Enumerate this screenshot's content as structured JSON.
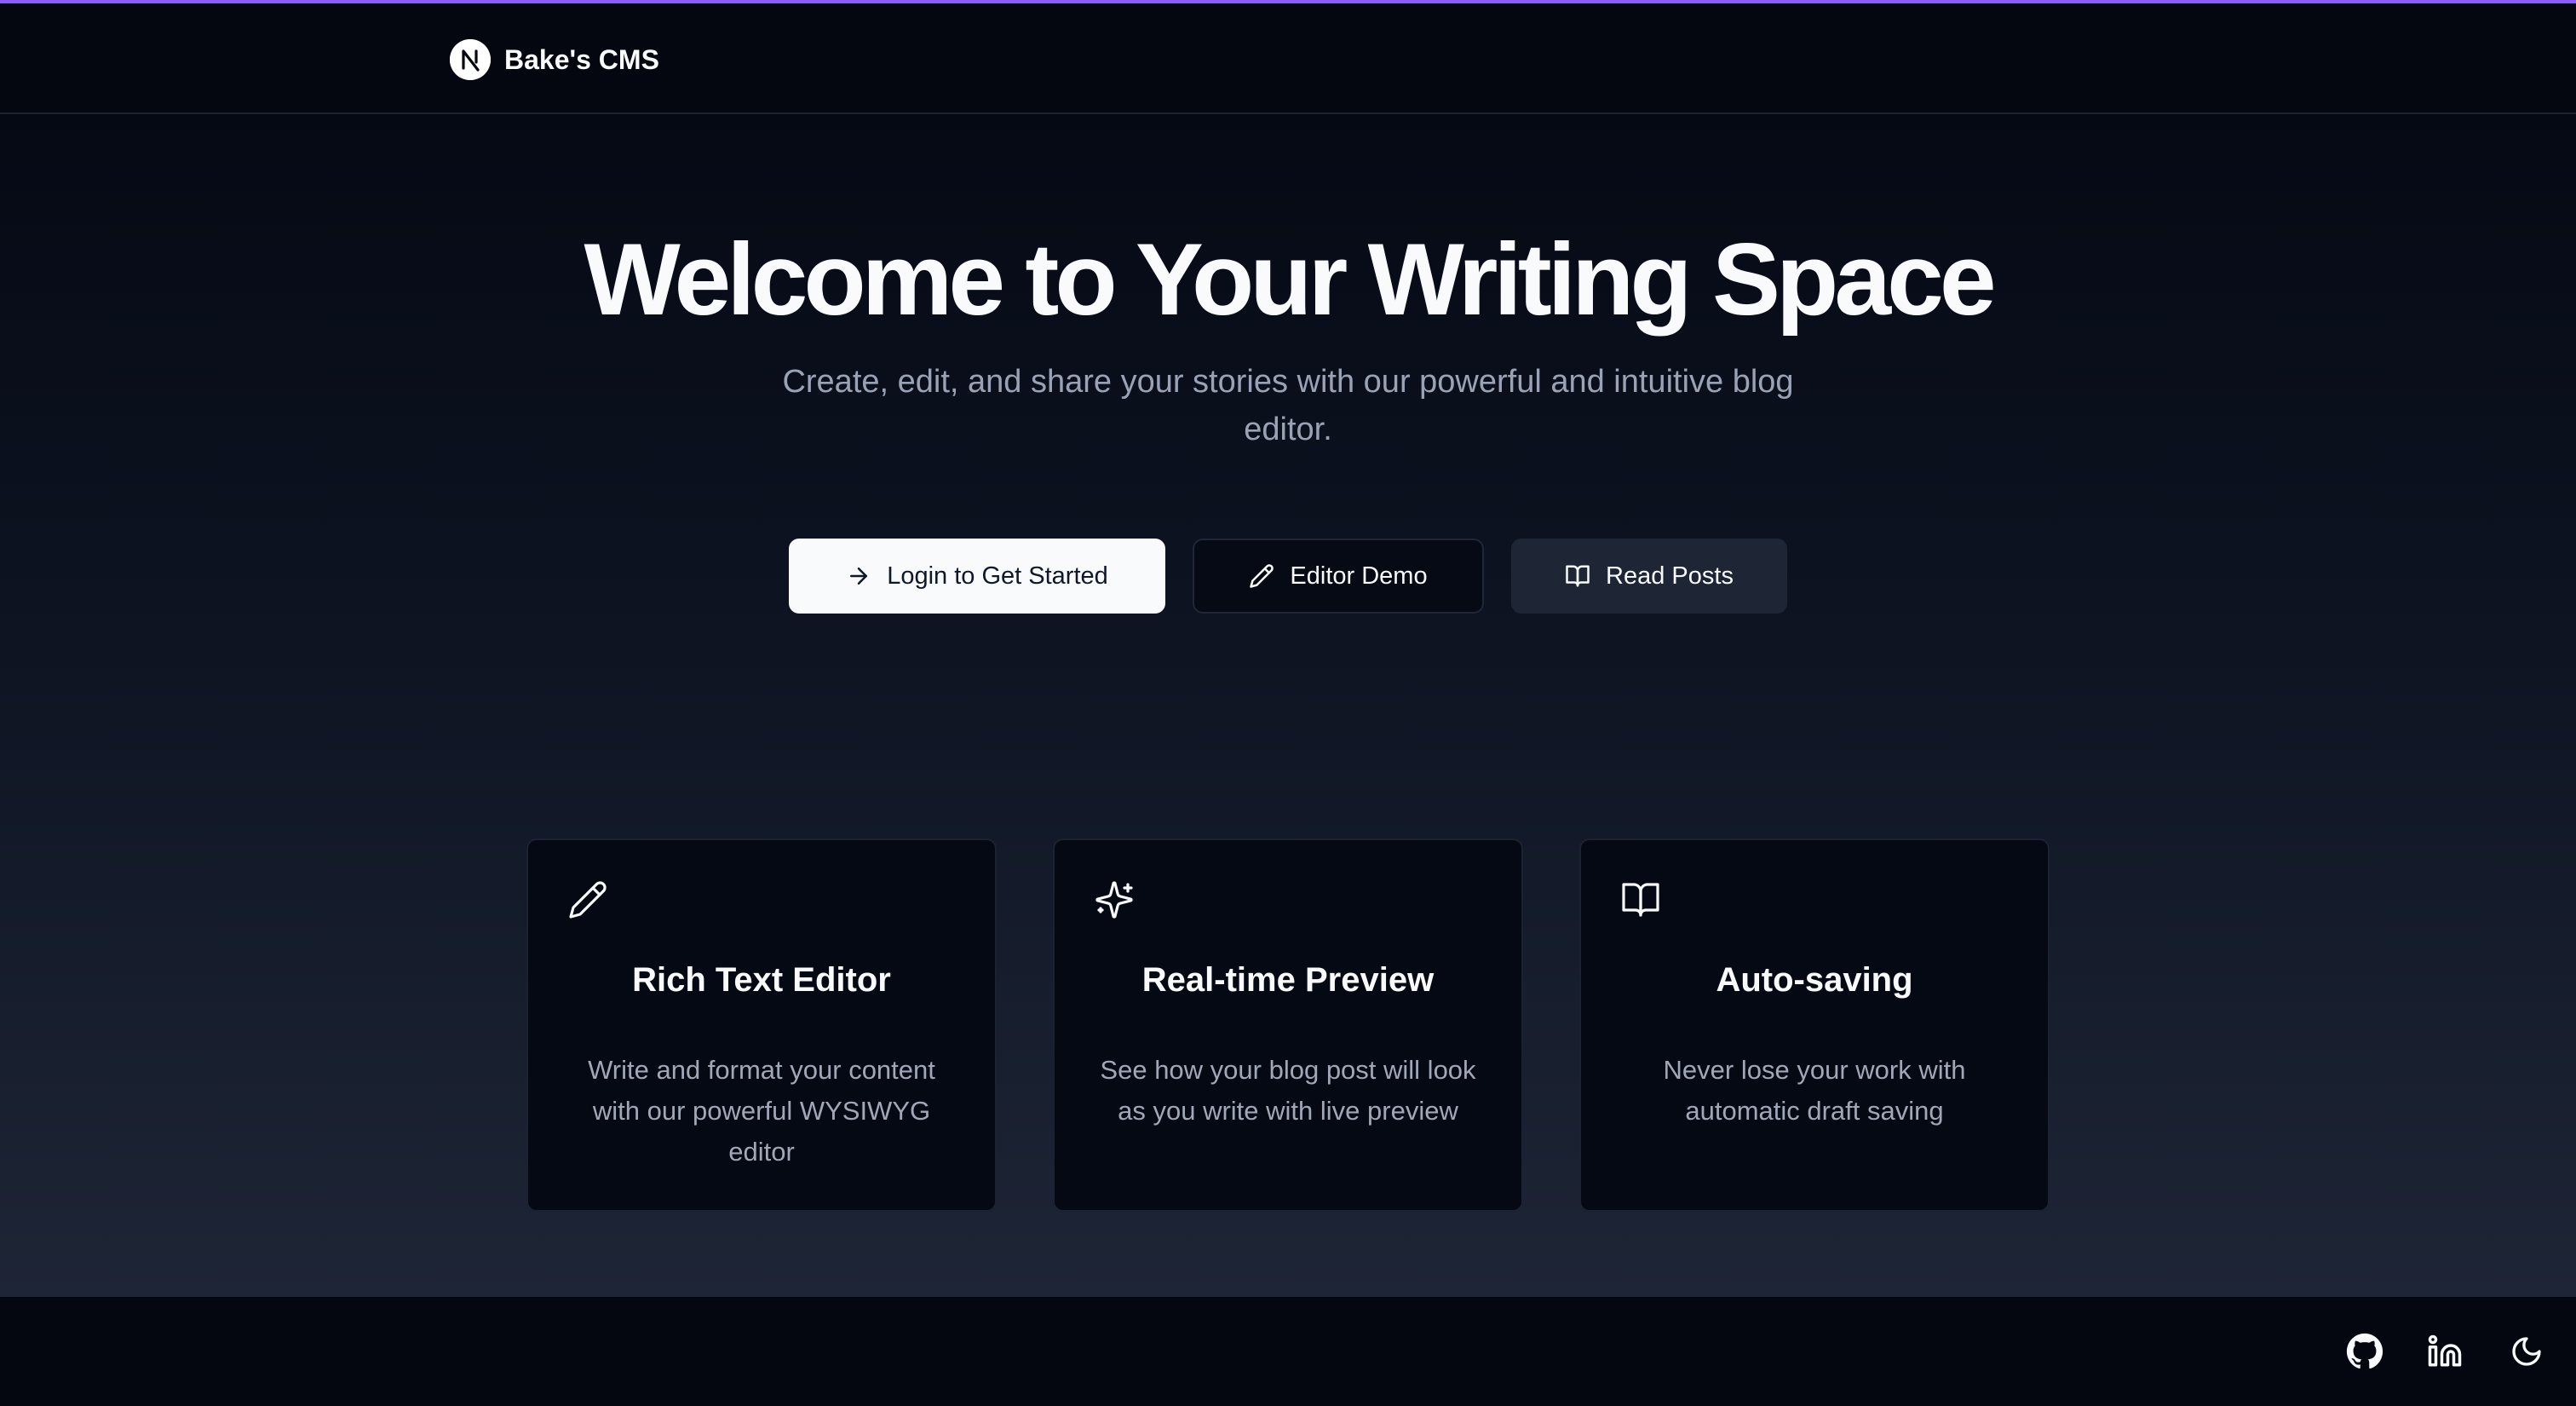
{
  "header": {
    "brand_name": "Bake's CMS",
    "logo_icon": "nextjs-logo-icon"
  },
  "hero": {
    "title": "Welcome to Your Writing Space",
    "subtitle": "Create, edit, and share your stories with our powerful and intuitive blog editor."
  },
  "actions": {
    "login": {
      "label": "Login to Get Started",
      "icon": "arrow-right-icon"
    },
    "editor_demo": {
      "label": "Editor Demo",
      "icon": "pencil-icon"
    },
    "read_posts": {
      "label": "Read Posts",
      "icon": "book-open-icon"
    }
  },
  "features": [
    {
      "icon": "pencil-icon",
      "title": "Rich Text Editor",
      "description": "Write and format your content with our powerful WYSIWYG editor"
    },
    {
      "icon": "sparkles-icon",
      "title": "Real-time Preview",
      "description": "See how your blog post will look as you write with live preview"
    },
    {
      "icon": "book-open-icon",
      "title": "Auto-saving",
      "description": "Never lose your work with automatic draft saving"
    }
  ],
  "footer": {
    "icons": [
      "github-icon",
      "linkedin-icon",
      "moon-icon"
    ]
  },
  "colors": {
    "background": "#04070f",
    "accent_line": "#8b5cf6",
    "primary_button": "#f8fafc",
    "muted_text": "#9aa3b5"
  }
}
